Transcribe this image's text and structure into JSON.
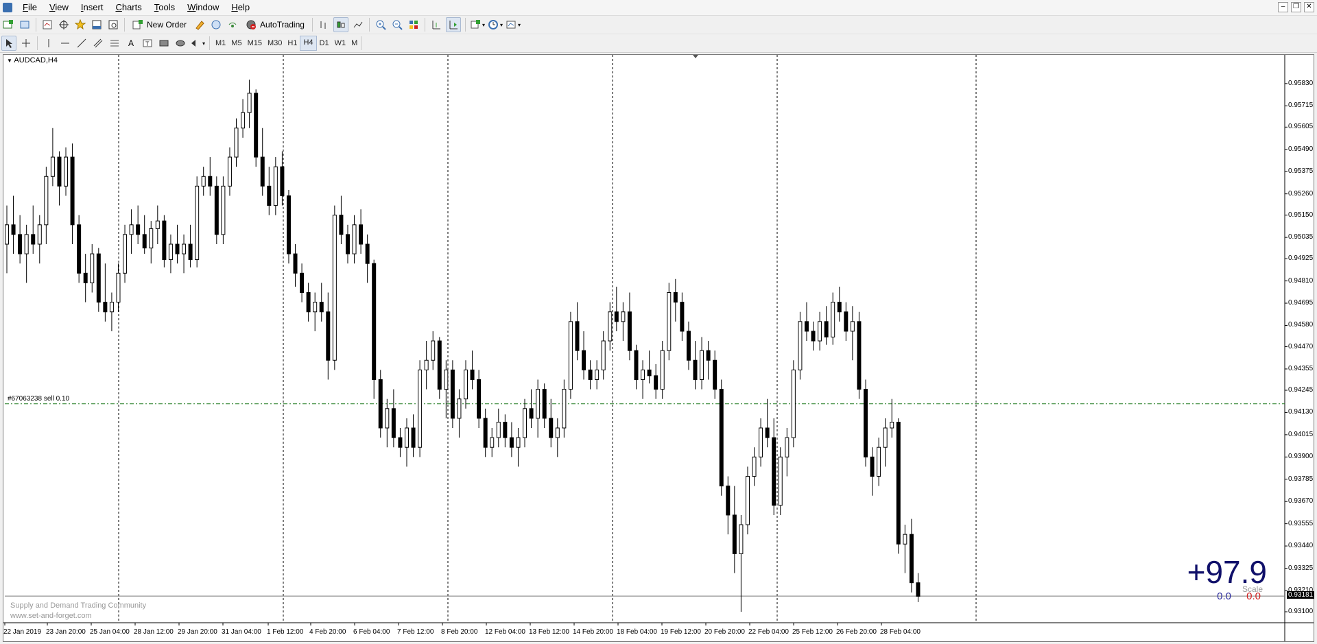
{
  "menu": [
    "File",
    "View",
    "Insert",
    "Charts",
    "Tools",
    "Window",
    "Help"
  ],
  "toolbar": {
    "new_order_label": "New Order",
    "autotrading_label": "AutoTrading"
  },
  "timeframes": [
    "M1",
    "M5",
    "M15",
    "M30",
    "H1",
    "H4",
    "D1",
    "W1",
    "MN"
  ],
  "active_timeframe": "H4",
  "chart": {
    "title": "AUDCAD,H4",
    "order_line_label": "#67063238 sell 0.10",
    "current_price": "0.93181",
    "profit_main": "+97.9",
    "profit_left": "0.0",
    "profit_right": "0.0",
    "scale_label": "Scale",
    "watermark_line1": "Supply and Demand Trading Community",
    "watermark_line2": "www.set-and-forget.com",
    "up_color": "#ffffff",
    "down_color": "#000000",
    "order_line_color": "#1f7a1f"
  },
  "chart_data": {
    "type": "candlestick",
    "title": "AUDCAD,H4",
    "y_ticks": [
      "0.95830",
      "0.95715",
      "0.95605",
      "0.95490",
      "0.95375",
      "0.95260",
      "0.95150",
      "0.95035",
      "0.94925",
      "0.94810",
      "0.94695",
      "0.94580",
      "0.94470",
      "0.94355",
      "0.94245",
      "0.94130",
      "0.94015",
      "0.93900",
      "0.93785",
      "0.93670",
      "0.93555",
      "0.93440",
      "0.93325",
      "0.93210",
      "0.93100"
    ],
    "ylim": [
      0.931,
      0.9595
    ],
    "x_tick_labels": [
      "22 Jan 2019",
      "23 Jan 20:00",
      "25 Jan 04:00",
      "28 Jan 12:00",
      "29 Jan 20:00",
      "31 Jan 04:00",
      "1 Feb 12:00",
      "4 Feb 20:00",
      "6 Feb 04:00",
      "7 Feb 12:00",
      "8 Feb 20:00",
      "12 Feb 04:00",
      "13 Feb 12:00",
      "14 Feb 20:00",
      "18 Feb 04:00",
      "19 Feb 12:00",
      "20 Feb 20:00",
      "22 Feb 04:00",
      "25 Feb 12:00",
      "26 Feb 20:00",
      "28 Feb 04:00"
    ],
    "sell_order_price": 0.94175,
    "current_price": 0.93181,
    "ohlc": [
      [
        0.95,
        0.952,
        0.9485,
        0.951
      ],
      [
        0.951,
        0.9525,
        0.9495,
        0.9505
      ],
      [
        0.9505,
        0.9515,
        0.949,
        0.9495
      ],
      [
        0.9495,
        0.951,
        0.948,
        0.9505
      ],
      [
        0.9505,
        0.952,
        0.9495,
        0.95
      ],
      [
        0.95,
        0.9515,
        0.949,
        0.951
      ],
      [
        0.951,
        0.954,
        0.95,
        0.9535
      ],
      [
        0.9535,
        0.956,
        0.953,
        0.9545
      ],
      [
        0.9545,
        0.9548,
        0.952,
        0.953
      ],
      [
        0.953,
        0.955,
        0.9525,
        0.9545
      ],
      [
        0.9545,
        0.9552,
        0.95,
        0.951
      ],
      [
        0.951,
        0.9515,
        0.948,
        0.9485
      ],
      [
        0.9485,
        0.9495,
        0.947,
        0.948
      ],
      [
        0.948,
        0.95,
        0.9475,
        0.9495
      ],
      [
        0.9495,
        0.9498,
        0.9465,
        0.947
      ],
      [
        0.947,
        0.949,
        0.946,
        0.9465
      ],
      [
        0.9465,
        0.9475,
        0.9455,
        0.947
      ],
      [
        0.947,
        0.949,
        0.9465,
        0.9485
      ],
      [
        0.9485,
        0.951,
        0.948,
        0.9505
      ],
      [
        0.9505,
        0.9518,
        0.9495,
        0.951
      ],
      [
        0.951,
        0.952,
        0.95,
        0.9505
      ],
      [
        0.9505,
        0.9515,
        0.9495,
        0.9498
      ],
      [
        0.9498,
        0.9512,
        0.949,
        0.9508
      ],
      [
        0.9508,
        0.952,
        0.95,
        0.9512
      ],
      [
        0.9512,
        0.9515,
        0.9488,
        0.9492
      ],
      [
        0.9492,
        0.9505,
        0.9485,
        0.95
      ],
      [
        0.95,
        0.951,
        0.949,
        0.9495
      ],
      [
        0.9495,
        0.9505,
        0.9485,
        0.95
      ],
      [
        0.95,
        0.951,
        0.9488,
        0.9492
      ],
      [
        0.9492,
        0.9535,
        0.9488,
        0.953
      ],
      [
        0.953,
        0.954,
        0.9525,
        0.9535
      ],
      [
        0.9535,
        0.9545,
        0.9525,
        0.953
      ],
      [
        0.953,
        0.9535,
        0.95,
        0.9505
      ],
      [
        0.9505,
        0.9535,
        0.95,
        0.953
      ],
      [
        0.953,
        0.955,
        0.9525,
        0.9545
      ],
      [
        0.9545,
        0.9565,
        0.954,
        0.956
      ],
      [
        0.956,
        0.9575,
        0.9555,
        0.9568
      ],
      [
        0.9568,
        0.9585,
        0.956,
        0.9578
      ],
      [
        0.9578,
        0.958,
        0.954,
        0.9545
      ],
      [
        0.9545,
        0.956,
        0.9525,
        0.953
      ],
      [
        0.953,
        0.954,
        0.9515,
        0.952
      ],
      [
        0.952,
        0.9545,
        0.9515,
        0.954
      ],
      [
        0.954,
        0.9548,
        0.952,
        0.9525
      ],
      [
        0.9525,
        0.9528,
        0.949,
        0.9495
      ],
      [
        0.9495,
        0.95,
        0.9478,
        0.9485
      ],
      [
        0.9485,
        0.949,
        0.947,
        0.9475
      ],
      [
        0.9475,
        0.948,
        0.946,
        0.9465
      ],
      [
        0.9465,
        0.9475,
        0.9455,
        0.947
      ],
      [
        0.947,
        0.948,
        0.946,
        0.9465
      ],
      [
        0.9465,
        0.9475,
        0.943,
        0.944
      ],
      [
        0.944,
        0.952,
        0.9435,
        0.9515
      ],
      [
        0.9515,
        0.9525,
        0.95,
        0.9505
      ],
      [
        0.9505,
        0.951,
        0.949,
        0.9495
      ],
      [
        0.9495,
        0.9515,
        0.949,
        0.951
      ],
      [
        0.951,
        0.9518,
        0.9495,
        0.95
      ],
      [
        0.95,
        0.9505,
        0.948,
        0.949
      ],
      [
        0.949,
        0.9492,
        0.942,
        0.943
      ],
      [
        0.943,
        0.9435,
        0.94,
        0.9405
      ],
      [
        0.9405,
        0.942,
        0.9395,
        0.9415
      ],
      [
        0.9415,
        0.9425,
        0.9395,
        0.94
      ],
      [
        0.94,
        0.9405,
        0.939,
        0.9395
      ],
      [
        0.9395,
        0.941,
        0.9385,
        0.9405
      ],
      [
        0.9405,
        0.9412,
        0.939,
        0.9395
      ],
      [
        0.9395,
        0.944,
        0.939,
        0.9435
      ],
      [
        0.9435,
        0.945,
        0.9425,
        0.944
      ],
      [
        0.944,
        0.9455,
        0.9435,
        0.945
      ],
      [
        0.945,
        0.9452,
        0.942,
        0.9425
      ],
      [
        0.9425,
        0.944,
        0.941,
        0.9435
      ],
      [
        0.9435,
        0.944,
        0.9405,
        0.941
      ],
      [
        0.941,
        0.9425,
        0.94,
        0.942
      ],
      [
        0.942,
        0.944,
        0.9415,
        0.9435
      ],
      [
        0.9435,
        0.9445,
        0.9425,
        0.943
      ],
      [
        0.943,
        0.9435,
        0.9405,
        0.941
      ],
      [
        0.941,
        0.9415,
        0.939,
        0.9395
      ],
      [
        0.9395,
        0.9405,
        0.939,
        0.94
      ],
      [
        0.94,
        0.9415,
        0.9395,
        0.9408
      ],
      [
        0.9408,
        0.9412,
        0.9395,
        0.94
      ],
      [
        0.94,
        0.9408,
        0.939,
        0.9395
      ],
      [
        0.9395,
        0.9405,
        0.9385,
        0.94
      ],
      [
        0.94,
        0.942,
        0.9395,
        0.9415
      ],
      [
        0.9415,
        0.9425,
        0.9405,
        0.941
      ],
      [
        0.941,
        0.943,
        0.94,
        0.9425
      ],
      [
        0.9425,
        0.9428,
        0.9405,
        0.941
      ],
      [
        0.941,
        0.942,
        0.9395,
        0.94
      ],
      [
        0.94,
        0.941,
        0.939,
        0.9405
      ],
      [
        0.9405,
        0.943,
        0.94,
        0.9425
      ],
      [
        0.9425,
        0.9465,
        0.942,
        0.946
      ],
      [
        0.946,
        0.947,
        0.944,
        0.9445
      ],
      [
        0.9445,
        0.9455,
        0.943,
        0.9435
      ],
      [
        0.9435,
        0.944,
        0.9425,
        0.943
      ],
      [
        0.943,
        0.944,
        0.9425,
        0.9435
      ],
      [
        0.9435,
        0.9455,
        0.943,
        0.945
      ],
      [
        0.945,
        0.947,
        0.9445,
        0.9465
      ],
      [
        0.9465,
        0.9478,
        0.9455,
        0.946
      ],
      [
        0.946,
        0.947,
        0.945,
        0.9465
      ],
      [
        0.9465,
        0.9475,
        0.944,
        0.9445
      ],
      [
        0.9445,
        0.9448,
        0.9425,
        0.943
      ],
      [
        0.943,
        0.944,
        0.942,
        0.9435
      ],
      [
        0.9435,
        0.9445,
        0.9428,
        0.9432
      ],
      [
        0.9432,
        0.9438,
        0.942,
        0.9425
      ],
      [
        0.9425,
        0.945,
        0.942,
        0.9445
      ],
      [
        0.9445,
        0.948,
        0.944,
        0.9475
      ],
      [
        0.9475,
        0.9482,
        0.946,
        0.947
      ],
      [
        0.947,
        0.9475,
        0.945,
        0.9455
      ],
      [
        0.9455,
        0.946,
        0.9435,
        0.944
      ],
      [
        0.944,
        0.945,
        0.9425,
        0.943
      ],
      [
        0.943,
        0.9452,
        0.9425,
        0.9445
      ],
      [
        0.9445,
        0.945,
        0.943,
        0.944
      ],
      [
        0.944,
        0.9445,
        0.942,
        0.9425
      ],
      [
        0.9425,
        0.943,
        0.937,
        0.9375
      ],
      [
        0.9375,
        0.938,
        0.935,
        0.936
      ],
      [
        0.936,
        0.9375,
        0.933,
        0.934
      ],
      [
        0.934,
        0.936,
        0.931,
        0.9355
      ],
      [
        0.9355,
        0.9385,
        0.935,
        0.938
      ],
      [
        0.938,
        0.9395,
        0.9375,
        0.939
      ],
      [
        0.939,
        0.941,
        0.9385,
        0.9405
      ],
      [
        0.9405,
        0.942,
        0.9395,
        0.94
      ],
      [
        0.94,
        0.941,
        0.936,
        0.9365
      ],
      [
        0.9365,
        0.9395,
        0.936,
        0.939
      ],
      [
        0.939,
        0.9405,
        0.938,
        0.94
      ],
      [
        0.94,
        0.944,
        0.9395,
        0.9435
      ],
      [
        0.9435,
        0.9465,
        0.943,
        0.946
      ],
      [
        0.946,
        0.947,
        0.945,
        0.9455
      ],
      [
        0.9455,
        0.946,
        0.9445,
        0.945
      ],
      [
        0.945,
        0.9465,
        0.9445,
        0.946
      ],
      [
        0.946,
        0.9468,
        0.9448,
        0.9452
      ],
      [
        0.9452,
        0.9475,
        0.9448,
        0.947
      ],
      [
        0.947,
        0.9478,
        0.946,
        0.9465
      ],
      [
        0.9465,
        0.947,
        0.945,
        0.9455
      ],
      [
        0.9455,
        0.9468,
        0.944,
        0.946
      ],
      [
        0.946,
        0.9465,
        0.942,
        0.9425
      ],
      [
        0.9425,
        0.943,
        0.9385,
        0.939
      ],
      [
        0.939,
        0.9395,
        0.937,
        0.938
      ],
      [
        0.938,
        0.94,
        0.9375,
        0.9395
      ],
      [
        0.9395,
        0.941,
        0.9385,
        0.9405
      ],
      [
        0.9405,
        0.942,
        0.94,
        0.9408
      ],
      [
        0.9408,
        0.941,
        0.934,
        0.9345
      ],
      [
        0.9345,
        0.9355,
        0.933,
        0.935
      ],
      [
        0.935,
        0.9358,
        0.932,
        0.9325
      ],
      [
        0.9325,
        0.933,
        0.9315,
        0.9318
      ]
    ]
  }
}
